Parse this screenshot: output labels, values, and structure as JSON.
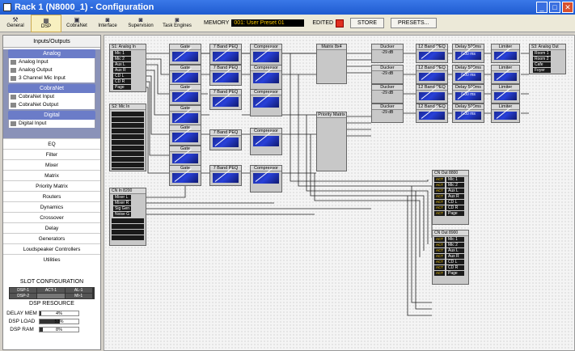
{
  "window": {
    "title": "Rack 1 (N8000_1) - Configuration"
  },
  "toolbar": {
    "tabs": [
      {
        "label": "General",
        "icon": "wrench-icon"
      },
      {
        "label": "DSP",
        "icon": "dsp-icon"
      },
      {
        "label": "CobraNet",
        "icon": "network-icon"
      },
      {
        "label": "Interface",
        "icon": "interface-icon"
      },
      {
        "label": "Supervision",
        "icon": "supervision-icon"
      },
      {
        "label": "Task Engines",
        "icon": "task-icon"
      }
    ],
    "memory_label": "MEMORY",
    "memory_value": "001: User Preset 01",
    "edited_label": "EDITED",
    "store": "STORE",
    "presets": "PRESETS..."
  },
  "left": {
    "header": "Inputs/Outputs",
    "categories": [
      {
        "name": "Analog",
        "items": [
          "Analog Input",
          "Analog Output",
          "3 Channel Mic Input"
        ]
      },
      {
        "name": "CobraNet",
        "items": [
          "CobraNet Input",
          "CobraNet Output"
        ]
      },
      {
        "name": "Digital",
        "items": [
          "Digital Input"
        ]
      }
    ],
    "nav": [
      "EQ",
      "Filter",
      "Mixer",
      "Matrix",
      "Priority Matrix",
      "Routers",
      "Dynamics",
      "Crossover",
      "Delay",
      "Generators",
      "Loudspeaker Controllers",
      "Utilities"
    ]
  },
  "slot": {
    "title": "SLOT CONFIGURATION",
    "r1": [
      "DSP-1",
      "ACT-1",
      "AL-1"
    ],
    "r2": [
      "DSP-2",
      "",
      "MI-1"
    ],
    "res_title": "DSP RESOURCE",
    "resources": [
      {
        "label": "DELAY MEM",
        "pct": "4%",
        "value": 4
      },
      {
        "label": "DSP LOAD",
        "pct": "53%",
        "value": 53
      },
      {
        "label": "DSP RAM",
        "pct": "8%",
        "value": 8
      }
    ]
  },
  "canvas": {
    "s1_title": "S1: Analog In",
    "s1_rows": [
      "Mic 1",
      "Mic 2",
      "Aux L",
      "Aux R",
      "CD L",
      "CD R",
      "Page"
    ],
    "s2_title": "S2: Mic In",
    "cn_title": "CN In 8200",
    "cn_rows": [
      "Mixer L",
      "Mixer R",
      "Sig Gen",
      "Noise G"
    ],
    "gates": [
      "Gate",
      "Gate",
      "Gate",
      "Gate",
      "Gate",
      "Gate",
      "Gate"
    ],
    "peq": [
      "7 Band PEQ",
      "7 Band PEQ",
      "7 Band PEQ",
      "7 Band PEQ",
      "7 Band PEQ"
    ],
    "comp": [
      "Compressor",
      "Compressor",
      "Compressor",
      "Compressor",
      "Compressor"
    ],
    "matrix": "Matrix 8x4",
    "priority": "Priority Matrix",
    "duckers": [
      "Ducker",
      "Ducker",
      "Ducker",
      "Ducker"
    ],
    "duck_db": "-29 dB",
    "peq12": [
      "12 Band PEQ",
      "12 Band PEQ",
      "12 Band PEQ",
      "12 Band PEQ"
    ],
    "delays": [
      "Delay 500ms",
      "Delay 500ms",
      "Delay 500ms",
      "Delay 500ms"
    ],
    "delay_val": "0.00 ms",
    "limiters": [
      "Limiter",
      "Limiter",
      "Limiter",
      "Limiter"
    ],
    "out_title": "S3: Analog Out",
    "out_rows": [
      "Room 1",
      "Room 2",
      "Cafe",
      "Foyer"
    ],
    "cnout1_title": "CN Out 8800",
    "cnout2_title": "CN Out 8900",
    "cnout_rows": [
      "Mic 1",
      "Mic 2",
      "Aux L",
      "Aux R",
      "CD L",
      "CD R",
      "Page"
    ],
    "act": "ACT"
  }
}
